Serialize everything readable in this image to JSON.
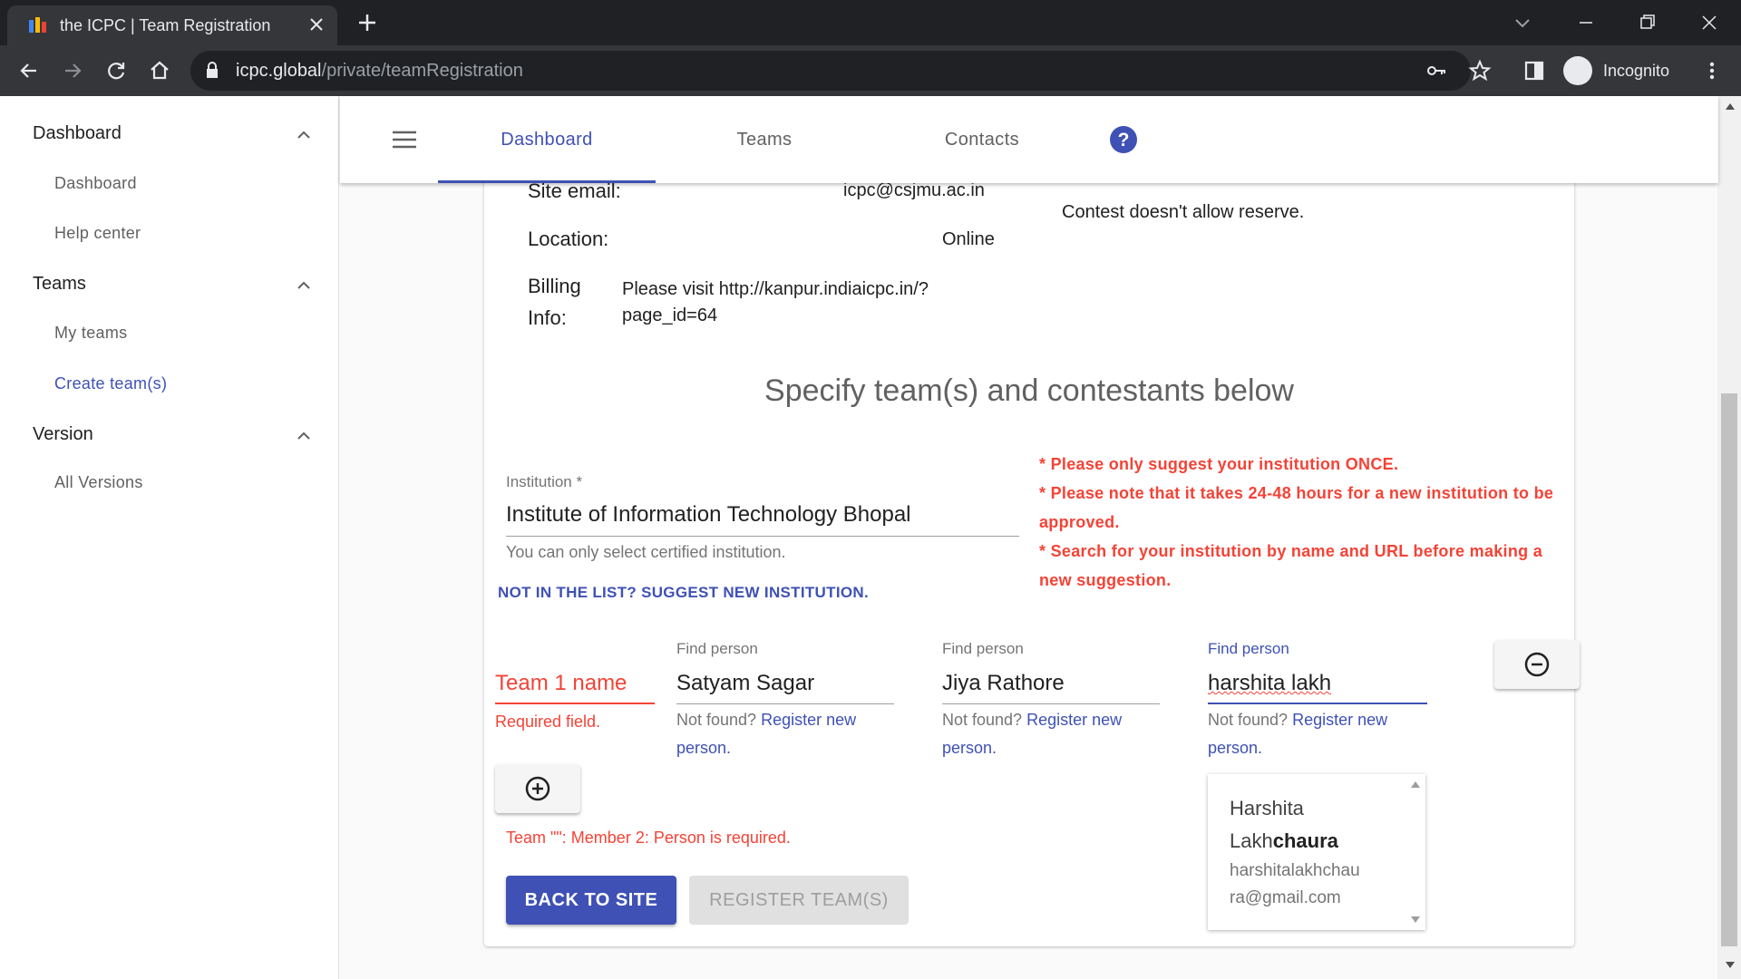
{
  "browser": {
    "tab_title": "the ICPC | Team Registration",
    "url_host": "icpc.global",
    "url_path": "/private/teamRegistration",
    "profile_label": "Incognito"
  },
  "sidebar": {
    "sections": [
      {
        "title": "Dashboard",
        "items": [
          "Dashboard",
          "Help center"
        ]
      },
      {
        "title": "Teams",
        "items": [
          "My teams",
          "Create team(s)"
        ]
      },
      {
        "title": "Version",
        "items": [
          "All Versions"
        ]
      }
    ],
    "active_item": "Create team(s)"
  },
  "topnav": {
    "tabs": [
      "Dashboard",
      "Teams",
      "Contacts"
    ],
    "active_tab": "Dashboard"
  },
  "site_info": {
    "email_label": "Site email:",
    "email_value": "icpc@csjmu.ac.in",
    "location_label": "Location:",
    "location_value": "Online",
    "billing_label_1": "Billing",
    "billing_label_2": "Info:",
    "billing_value_1": "Please visit http://kanpur.indiaicpc.in/?",
    "billing_value_2": "page_id=64",
    "reserve_note": "Contest doesn't allow reserve."
  },
  "form": {
    "heading": "Specify team(s) and contestants below",
    "institution_label": "Institution *",
    "institution_value": "Institute of Information Technology Bhopal",
    "institution_hint": "You can only select certified institution.",
    "suggest_link": "NOT IN THE LIST? SUGGEST NEW INSTITUTION.",
    "warnings": [
      "* Please only suggest your institution ONCE.",
      "* Please note that it takes 24-48 hours for a new institution to be",
      "approved.",
      "* Search for your institution by name and URL before making a",
      "new suggestion."
    ],
    "team_name_placeholder": "Team 1 name",
    "team_name_error": "Required field.",
    "find_person_label": "Find person",
    "not_found_text": "Not found?",
    "register_link_1": "Register new",
    "register_link_2": "person.",
    "members": [
      "Satyam Sagar",
      "Jiya Rathore",
      "harshita lakh"
    ],
    "validation_error": "Team \"\": Member 2: Person is required."
  },
  "dropdown": {
    "name_line1": "Harshita",
    "name_plain": "Lakh",
    "name_bold": "chaura",
    "email_line1": "harshitalakhchau",
    "email_line2": "ra@gmail.com"
  },
  "buttons": {
    "back": "BACK TO SITE",
    "register": "REGISTER TEAM(S)"
  },
  "colors": {
    "primary": "#3f51b5",
    "error": "#f44336",
    "chrome_dark": "#202124",
    "chrome_tab": "#35363a"
  }
}
